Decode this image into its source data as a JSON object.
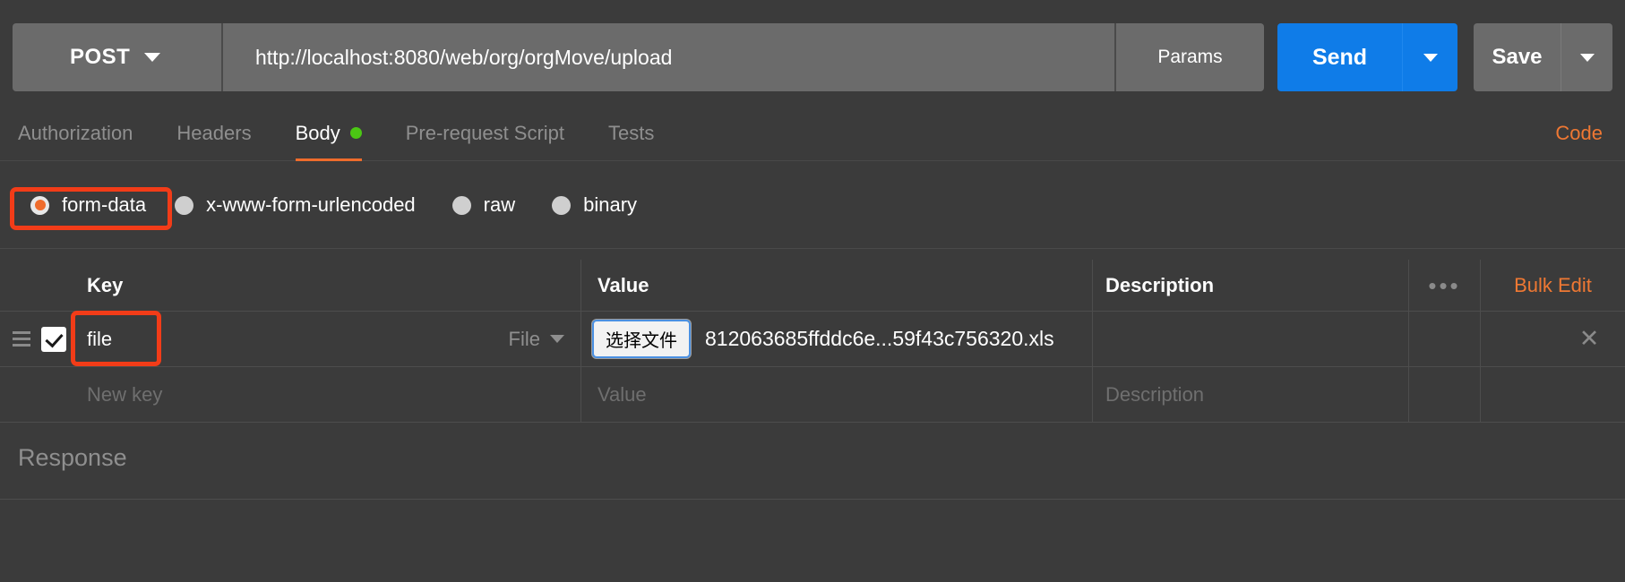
{
  "request": {
    "method": "POST",
    "method_caret_icon": "chevron-down-icon",
    "url": "http://localhost:8080/web/org/orgMove/upload",
    "params_label": "Params",
    "send_label": "Send",
    "send_caret_icon": "chevron-down-icon",
    "save_label": "Save",
    "save_caret_icon": "chevron-down-icon"
  },
  "tabs": {
    "items": [
      {
        "label": "Authorization",
        "active": false,
        "dot": false
      },
      {
        "label": "Headers",
        "active": false,
        "dot": false
      },
      {
        "label": "Body",
        "active": true,
        "dot": true
      },
      {
        "label": "Pre-request Script",
        "active": false,
        "dot": false
      },
      {
        "label": "Tests",
        "active": false,
        "dot": false
      }
    ],
    "code_link": "Code"
  },
  "body_types": {
    "options": [
      {
        "label": "form-data",
        "selected": true
      },
      {
        "label": "x-www-form-urlencoded",
        "selected": false
      },
      {
        "label": "raw",
        "selected": false
      },
      {
        "label": "binary",
        "selected": false
      }
    ]
  },
  "table": {
    "headers": {
      "key": "Key",
      "value": "Value",
      "description": "Description",
      "more_icon": "•••",
      "bulk_edit": "Bulk Edit"
    },
    "rows": [
      {
        "checked": true,
        "drag_icon": "drag-handle-icon",
        "key": "file",
        "type": "File",
        "file_button": "选择文件",
        "file_name": "812063685ffddc6e...59f43c756320.xls",
        "description": "",
        "delete_icon": "✕"
      }
    ],
    "new_row": {
      "key_placeholder": "New key",
      "value_placeholder": "Value",
      "description_placeholder": "Description"
    }
  },
  "response": {
    "title": "Response"
  },
  "colors": {
    "accent_orange": "#ef6c2c",
    "send_blue": "#0f7ce8",
    "annotation_red": "#f23c18",
    "dot_green": "#4bc714",
    "panel_bg": "#3b3b3b",
    "input_bg": "#6b6b6b"
  }
}
